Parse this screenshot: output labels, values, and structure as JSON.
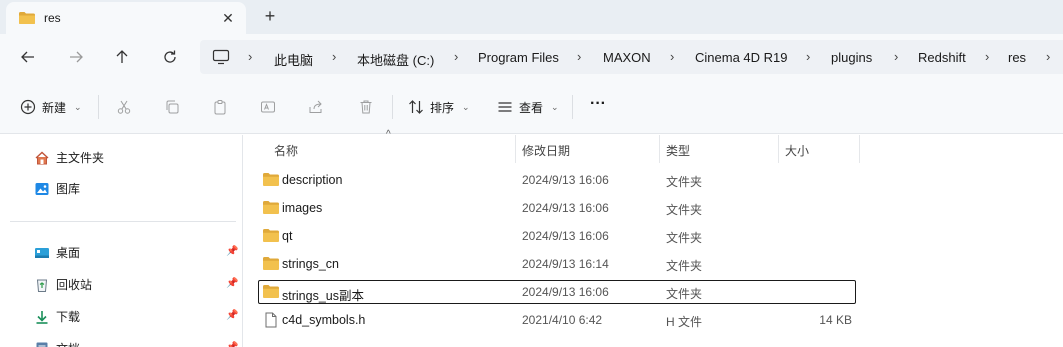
{
  "tab": {
    "title": "res",
    "close_glyph": "✕",
    "new_tab_glyph": "+"
  },
  "nav": {
    "back_glyph": "←",
    "forward_glyph": "→",
    "up_glyph": "↑",
    "refresh_glyph": "↻"
  },
  "breadcrumb": [
    "此电脑",
    "本地磁盘 (C:)",
    "Program Files",
    "MAXON",
    "Cinema 4D R19",
    "plugins",
    "Redshift",
    "res"
  ],
  "breadcrumb_sep": "›",
  "commands": {
    "new_label": "新建",
    "sort_label": "排序",
    "view_label": "查看",
    "more_glyph": "···"
  },
  "sidebar": {
    "items": [
      {
        "label": "主文件夹",
        "icon": "home-icon",
        "pinned": false
      },
      {
        "label": "图库",
        "icon": "gallery-icon",
        "pinned": false
      },
      {
        "label": "桌面",
        "icon": "desktop-icon",
        "pinned": true
      },
      {
        "label": "回收站",
        "icon": "recycle-bin-icon",
        "pinned": true
      },
      {
        "label": "下载",
        "icon": "download-icon",
        "pinned": true
      },
      {
        "label": "文档",
        "icon": "documents-icon",
        "pinned": true
      }
    ],
    "pin_glyph": "📌"
  },
  "columns": {
    "name": "名称",
    "date": "修改日期",
    "type": "类型",
    "size": "大小"
  },
  "files": [
    {
      "name": "description",
      "date": "2024/9/13 16:06",
      "type": "文件夹",
      "size": "",
      "icon": "folder-icon",
      "selected": false
    },
    {
      "name": "images",
      "date": "2024/9/13 16:06",
      "type": "文件夹",
      "size": "",
      "icon": "folder-icon",
      "selected": false
    },
    {
      "name": "qt",
      "date": "2024/9/13 16:06",
      "type": "文件夹",
      "size": "",
      "icon": "folder-icon",
      "selected": false
    },
    {
      "name": "strings_cn",
      "date": "2024/9/13 16:14",
      "type": "文件夹",
      "size": "",
      "icon": "folder-icon",
      "selected": false
    },
    {
      "name": "strings_us副本",
      "date": "2024/9/13 16:06",
      "type": "文件夹",
      "size": "",
      "icon": "folder-icon",
      "selected": true
    },
    {
      "name": "c4d_symbols.h",
      "date": "2021/4/10 6:42",
      "type": "H 文件",
      "size": "14 KB",
      "icon": "file-icon",
      "selected": false
    }
  ],
  "colors": {
    "folder": "#f2c14e",
    "folder_dark": "#e0a93a",
    "accent": "#0067c0"
  }
}
